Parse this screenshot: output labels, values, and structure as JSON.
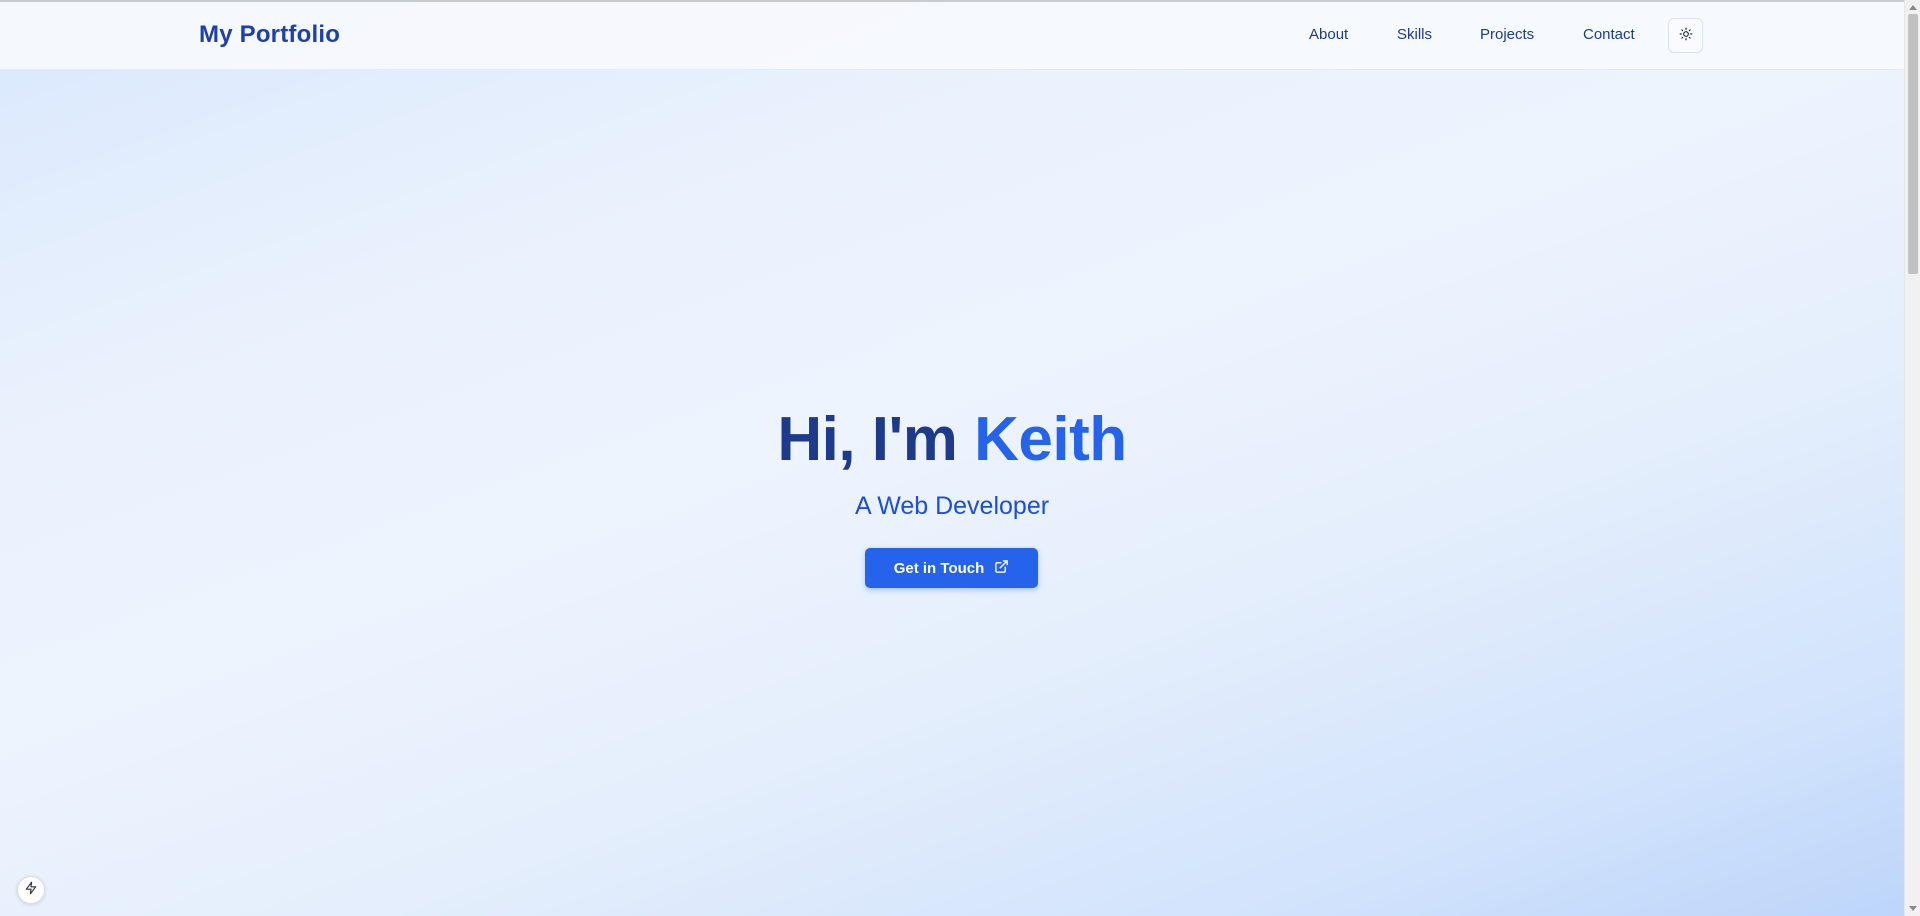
{
  "navbar": {
    "brand": "My Portfolio",
    "links": [
      {
        "label": "About"
      },
      {
        "label": "Skills"
      },
      {
        "label": "Projects"
      },
      {
        "label": "Contact"
      }
    ],
    "theme_toggle_icon": "sun-icon"
  },
  "hero": {
    "greeting": "Hi, I'm ",
    "name": "Keith",
    "subtitle": "A Web Developer",
    "cta_label": "Get in Touch",
    "cta_icon": "external-link-icon"
  },
  "dev_badge_icon": "lightning-icon",
  "colors": {
    "brand": "#1e40af",
    "title": "#1e3a8a",
    "accent": "#2563eb",
    "button_bg": "#2563eb"
  }
}
